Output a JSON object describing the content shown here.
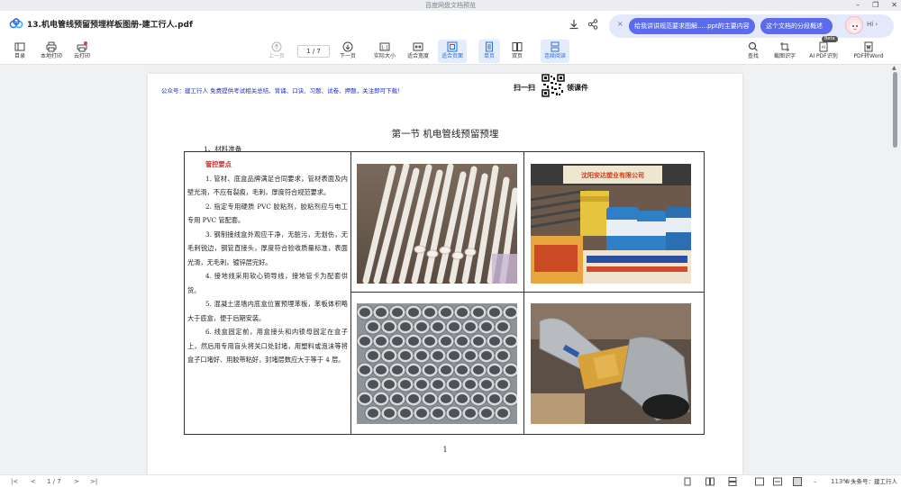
{
  "window": {
    "title": "百度网盘文档预览",
    "controls": [
      "–",
      "❐",
      "✕"
    ]
  },
  "titlebar": {
    "doc_title": "13.机电管线预留预埋样板图册-建工行人.pdf"
  },
  "ai_assistant": {
    "close_label": "×",
    "pill1": "给我讲讲规范要求图解.....ppt的主要内容",
    "pill2": "这个文档的分段概述",
    "greeting": "Hi ›"
  },
  "toolbar": {
    "catalog": "目录",
    "local_print": "本地打印",
    "cloud_print": "云打印",
    "prev_page": "上一页",
    "page_indicator": "1 / 7",
    "next_page": "下一页",
    "actual_size": "实际大小",
    "fit_width": "适合宽度",
    "fit_page": "适合页面",
    "single_page": "单页",
    "double_page": "双页",
    "continuous": "连续阅读",
    "find": "查找",
    "screenshot_ocr": "截图识字",
    "ai_pdf": "AI PDF识别",
    "ai_badge": "Beta",
    "pdf_to_word": "PDF转Word"
  },
  "document": {
    "promo": "公众号：建工行人 免费提供考试相关总结、背诵、口诀、习题、试卷、押题，关注即可下载！",
    "qr_label_left": "扫一扫",
    "qr_label_right": "领课件",
    "section_title": "第一节 机电管线预留预埋",
    "material_heading": "1、材料准备",
    "key_points_title": "管控要点",
    "paragraphs": [
      "1. 管材、底盒品牌满足合同要求，管材表面及内壁光滑，不应有裂痕，毛刺，厚度符合规范要求。",
      "2. 指定专用硬质 PVC 胶粘剂，胶粘剂应与电工专用 PVC 管配套。",
      "3. 钢制接线盒外观应干净，无脏污，无划伤，无毛刺锐边，钢管直接头，厚度符合验收质量标准，表面光滑，无毛刺，镀锌层完好。",
      "4. 接地线采用软心铜导线，接地管卡为配套供货。",
      "5. 混凝土竖墙内底盒位置预埋苯板，苯板体积略大于底盒，便于后期安装。",
      "6. 线盒固定前，用盒接头和内锁母固定在盒子上，然后用专用盲头将关口处封堵，用塑料或泡沫等将盒子口堵好、用胶带粘好，封堵层数应大于等于 4 层。"
    ],
    "photo2_sign": "沈阳安达塑业有限公司",
    "page_number": "1"
  },
  "statusbar": {
    "first": "|<",
    "prev": "<",
    "page_indicator": "1 / 7",
    "next": ">",
    "last": ">|",
    "zoom": "113%",
    "watermark": "©头条号：建工行人"
  },
  "colors": {
    "accent": "#5b6be9",
    "promo_text": "#1a2fd0",
    "key_points": "#e22020"
  }
}
